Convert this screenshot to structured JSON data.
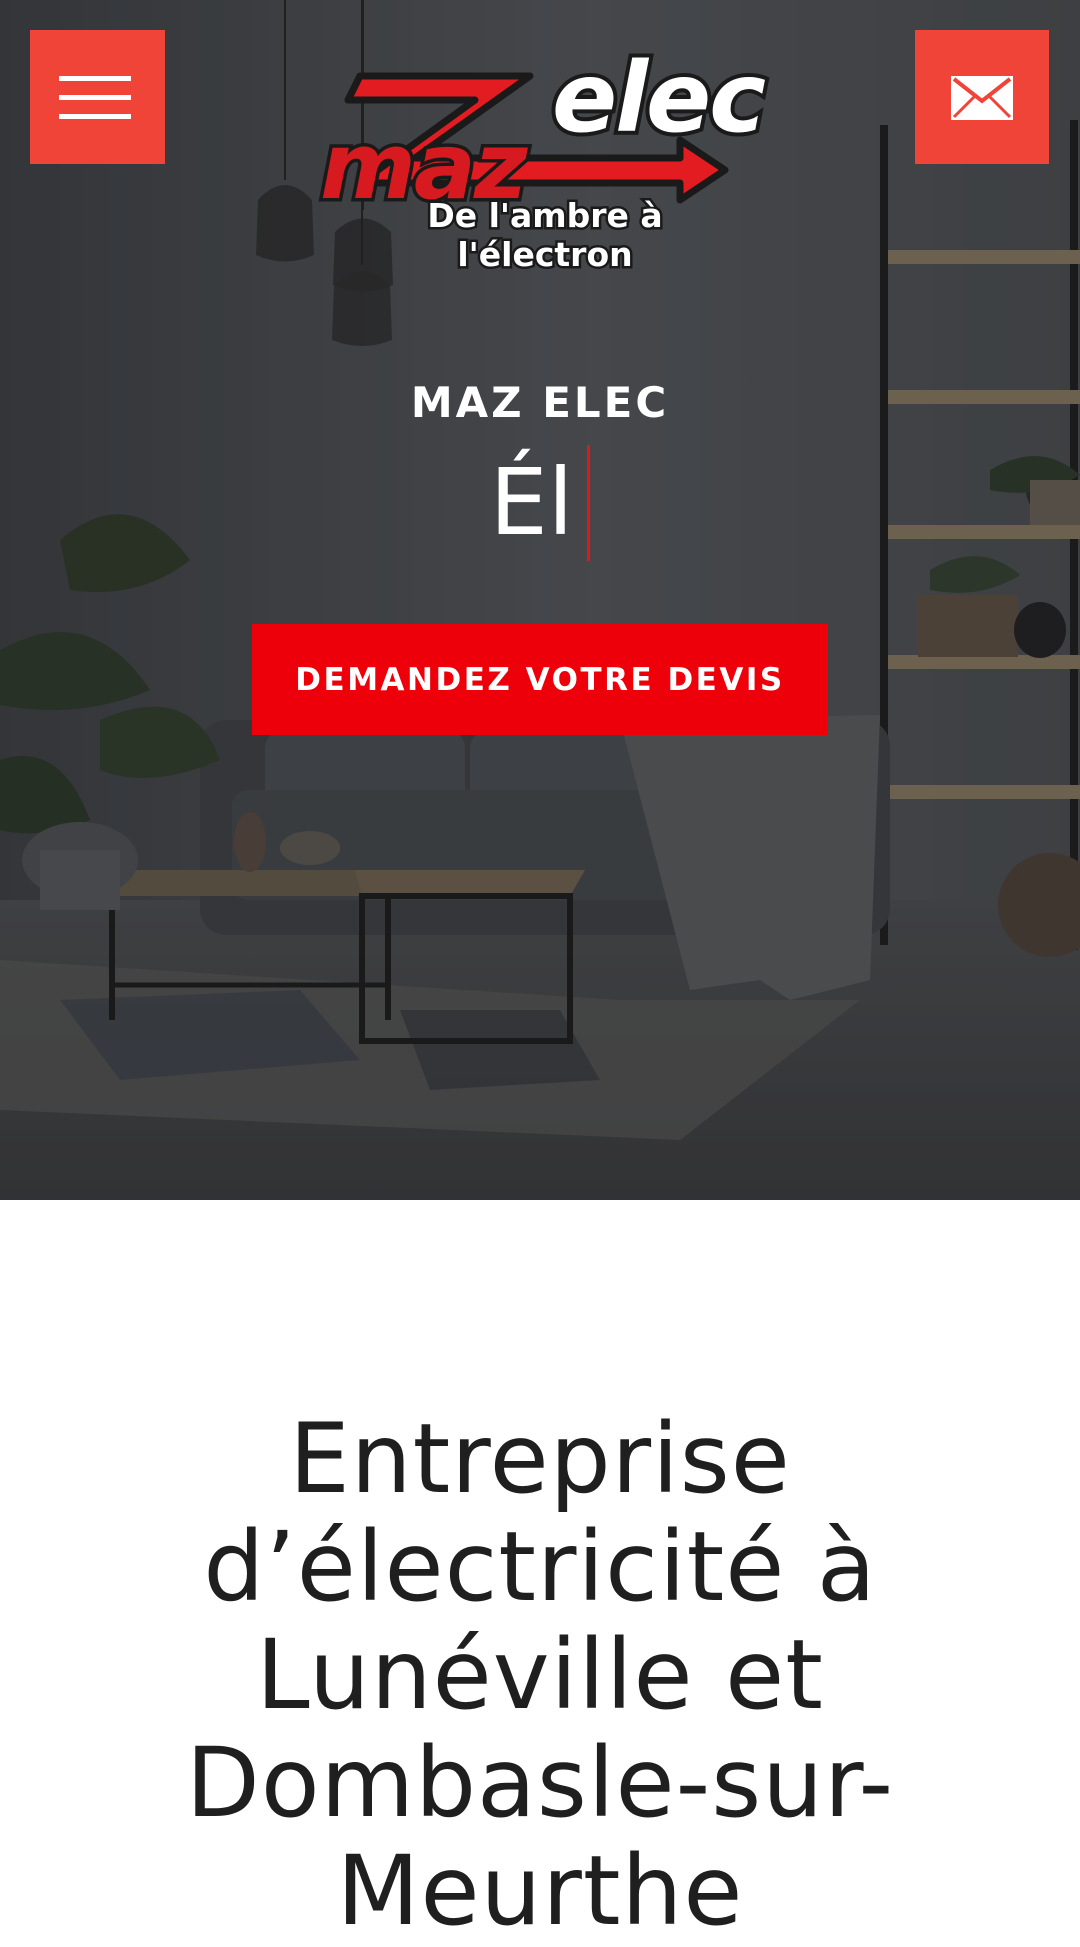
{
  "header": {
    "menu_icon": "hamburger-menu-icon",
    "mail_icon": "envelope-icon",
    "accent_color": "#f04438",
    "logo": {
      "word_left": "maz",
      "word_right": "elec",
      "tagline": "De l'ambre à l'électron"
    }
  },
  "hero": {
    "eyebrow": "MAZ ELEC",
    "typed_text": "Él",
    "cta_label": "DEMANDEZ VOTRE DEVIS",
    "cta_color": "#ed0009"
  },
  "intro": {
    "heading": "Entreprise d’électricité à Lunéville et Dombasle-sur-Meurthe"
  }
}
